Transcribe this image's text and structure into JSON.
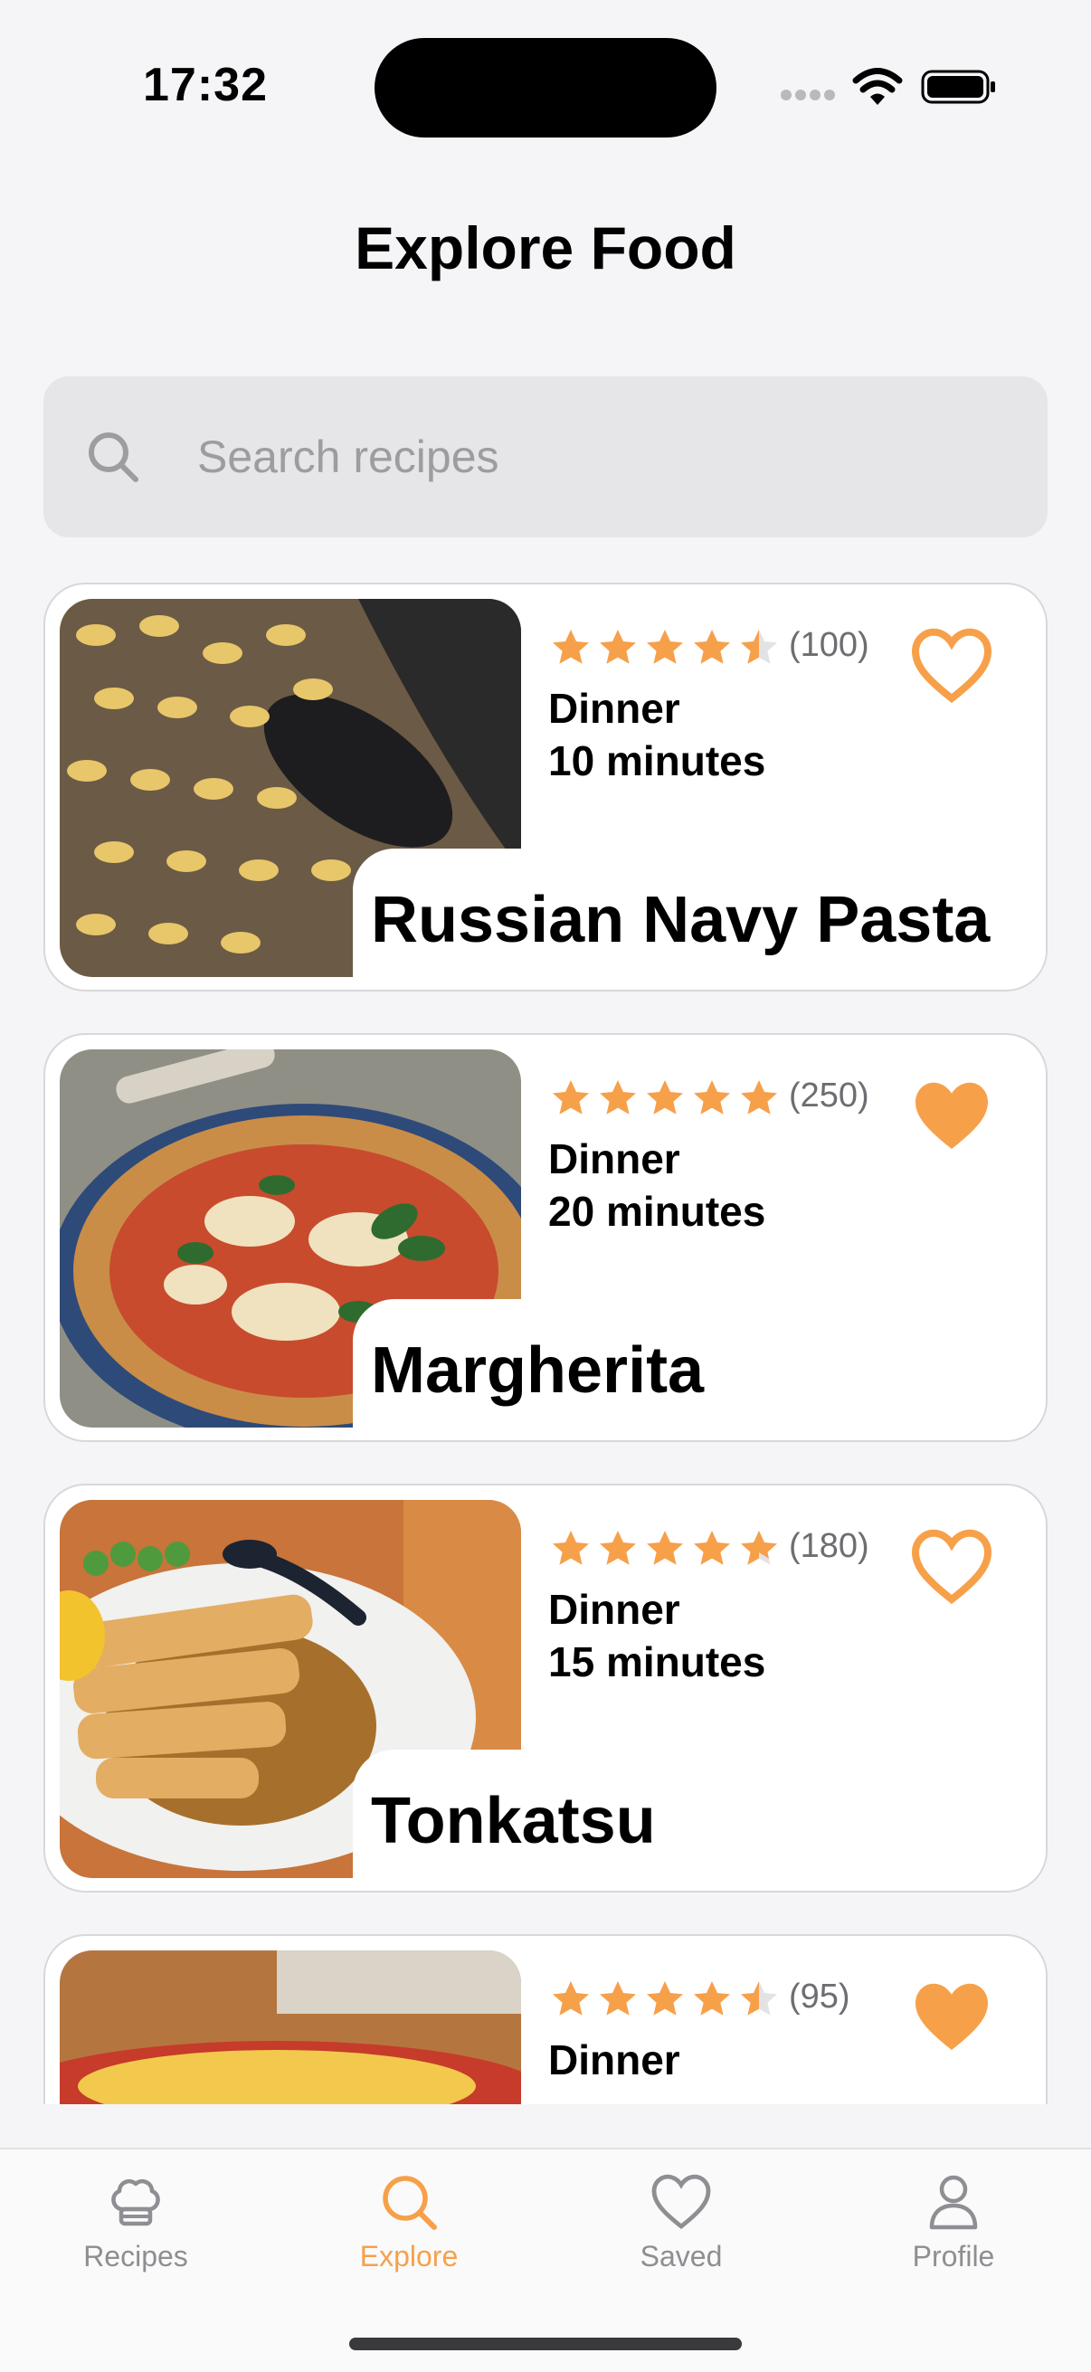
{
  "status_bar": {
    "time": "17:32"
  },
  "page_title": "Explore Food",
  "search": {
    "placeholder": "Search recipes"
  },
  "accent_color": "#F7A04A",
  "recipes": [
    {
      "title": "Russian Navy Pasta",
      "rating": 4.5,
      "review_count": "(100)",
      "meal_type": "Dinner",
      "cook_time": "10 minutes",
      "favorited": false,
      "image": "pasta"
    },
    {
      "title": "Margherita",
      "rating": 5,
      "review_count": "(250)",
      "meal_type": "Dinner",
      "cook_time": "20 minutes",
      "favorited": true,
      "image": "pizza"
    },
    {
      "title": "Tonkatsu",
      "rating": 4.5,
      "review_count": "(180)",
      "meal_type": "Dinner",
      "cook_time": "15 minutes",
      "favorited": false,
      "image": "tonkatsu"
    },
    {
      "title": "",
      "rating": 4.5,
      "review_count": "(95)",
      "meal_type": "Dinner",
      "cook_time": "",
      "favorited": true,
      "image": "omelette"
    }
  ],
  "tab_bar": {
    "active": "explore",
    "tabs": [
      {
        "id": "recipes",
        "label": "Recipes",
        "icon": "chef-hat-icon"
      },
      {
        "id": "explore",
        "label": "Explore",
        "icon": "search-icon"
      },
      {
        "id": "saved",
        "label": "Saved",
        "icon": "heart-icon"
      },
      {
        "id": "profile",
        "label": "Profile",
        "icon": "person-icon"
      }
    ]
  }
}
